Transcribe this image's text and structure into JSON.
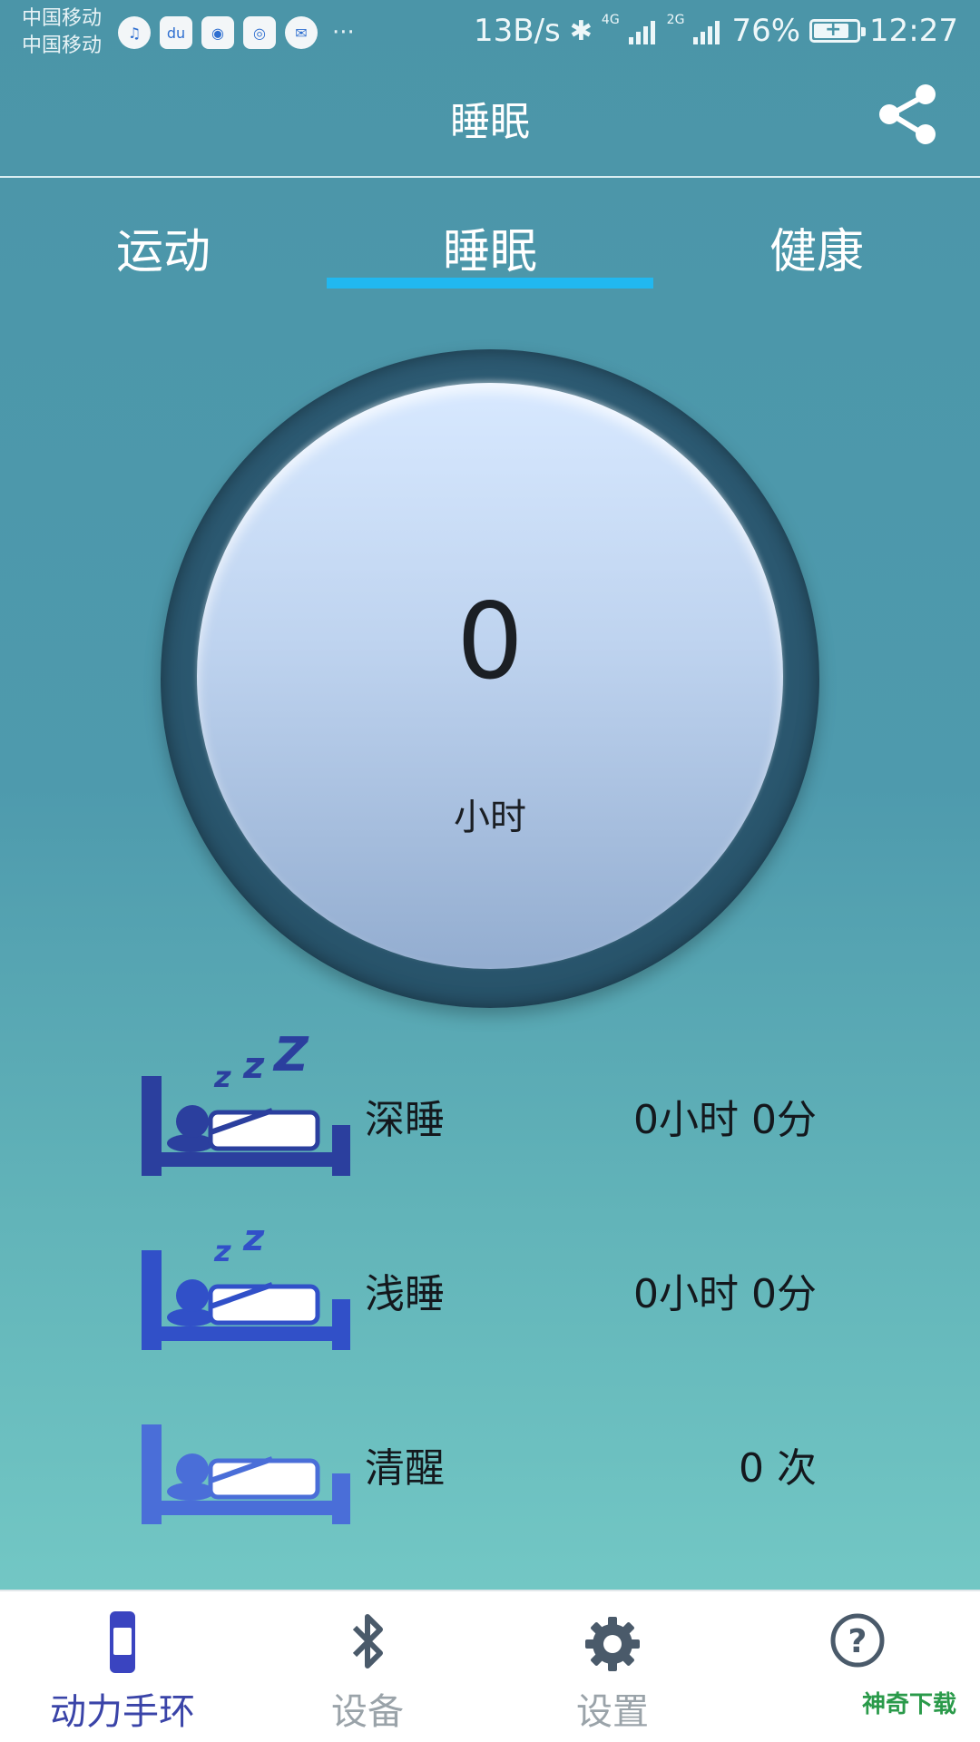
{
  "status_bar": {
    "carrier_1": "中国移动",
    "carrier_2": "中国移动",
    "speed": "13B/s",
    "net_4g": "4G",
    "net_2g": "2G",
    "battery": "76%",
    "time": "12:27"
  },
  "header": {
    "title": "睡眠"
  },
  "tabs": [
    {
      "label": "运动",
      "active": false
    },
    {
      "label": "睡眠",
      "active": true
    },
    {
      "label": "健康",
      "active": false
    }
  ],
  "dial": {
    "value": "0",
    "unit": "小时"
  },
  "sleep_rows": [
    {
      "label": "深睡",
      "value": "0小时 0分",
      "icon": "deep-sleep-bed-icon"
    },
    {
      "label": "浅睡",
      "value": "0小时 0分",
      "icon": "light-sleep-bed-icon"
    },
    {
      "label": "清醒",
      "value": "0 次",
      "icon": "awake-bed-icon"
    }
  ],
  "bottom_nav": [
    {
      "label": "动力手环",
      "icon": "band-icon",
      "active": true
    },
    {
      "label": "设备",
      "icon": "bluetooth-icon",
      "active": false
    },
    {
      "label": "设置",
      "icon": "gear-icon",
      "active": false
    },
    {
      "label": "",
      "icon": "help-icon",
      "active": false
    }
  ],
  "watermark": "神奇下载",
  "colors": {
    "tab_indicator": "#21b8f0",
    "nav_active": "#3a44a8",
    "bed_deep": "#2b3f9e",
    "bed_light": "#3150c8",
    "bed_awake": "#4a6ed8"
  }
}
